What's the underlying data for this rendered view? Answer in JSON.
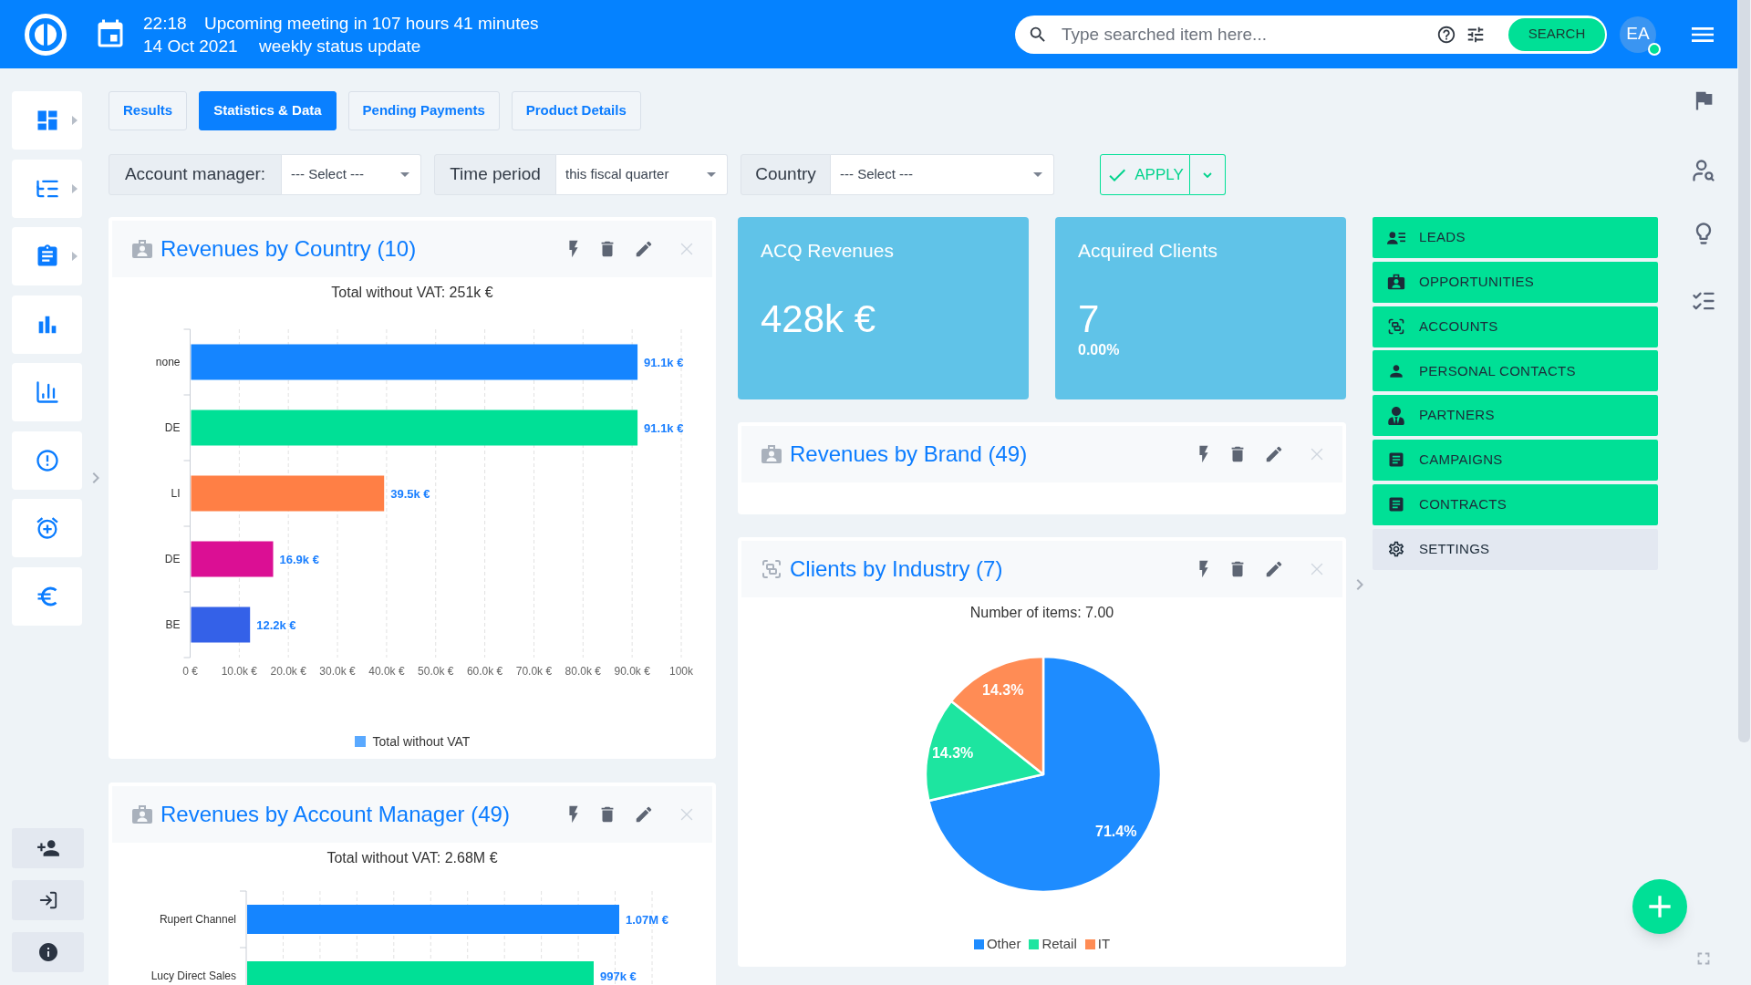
{
  "header": {
    "time": "22:18",
    "meeting": "Upcoming meeting in 107 hours 41 minutes",
    "date": "14 Oct 2021",
    "event": "weekly status update",
    "search": {
      "placeholder": "Type searched item here...",
      "button": "SEARCH"
    },
    "avatar": {
      "initials": "EA",
      "online": true
    }
  },
  "sidebar": {
    "items": [
      {
        "expandable": true
      },
      {
        "expandable": true
      },
      {
        "expandable": true
      },
      {
        "expandable": false
      },
      {
        "expandable": false
      },
      {
        "expandable": false
      },
      {
        "expandable": false
      },
      {
        "expandable": false
      }
    ]
  },
  "tabs": [
    {
      "label": "Results",
      "selected": false
    },
    {
      "label": "Statistics & Data",
      "selected": true
    },
    {
      "label": "Pending Payments",
      "selected": false
    },
    {
      "label": "Product Details",
      "selected": false
    }
  ],
  "filters": {
    "fields": [
      {
        "label": "Account manager:",
        "value": "--- Select ---"
      },
      {
        "label": "Time period",
        "value": "this fiscal quarter"
      },
      {
        "label": "Country",
        "value": "--- Select ---"
      }
    ],
    "apply": "APPLY"
  },
  "left_column": {
    "widgets": [
      {
        "title": "Revenues by Country (10)",
        "chart_data": {
          "type": "bar",
          "orientation": "horizontal",
          "title": "Total without VAT: 251k €",
          "categories": [
            "none",
            "DE",
            "LI",
            "DE",
            "BE"
          ],
          "series": [
            {
              "name": "Total without VAT",
              "color": "#5aa9ff",
              "values": [
                91100,
                91100,
                39500,
                16900,
                12200
              ],
              "colors": [
                "#1585ff",
                "#00e096",
                "#ff7f45",
                "#db0f94",
                "#3461e8"
              ]
            }
          ],
          "value_labels": [
            "91.1k €",
            "91.1k €",
            "39.5k €",
            "16.9k €",
            "12.2k €"
          ],
          "xlim": [
            0,
            100000
          ],
          "xticks": [
            {
              "value": 0,
              "label": "0 €"
            },
            {
              "value": 10000,
              "label": "10.0k €"
            },
            {
              "value": 20000,
              "label": "20.0k €"
            },
            {
              "value": 30000,
              "label": "30.0k €"
            },
            {
              "value": 40000,
              "label": "40.0k €"
            },
            {
              "value": 50000,
              "label": "50.0k €"
            },
            {
              "value": 60000,
              "label": "60.0k €"
            },
            {
              "value": 70000,
              "label": "70.0k €"
            },
            {
              "value": 80000,
              "label": "80.0k €"
            },
            {
              "value": 90000,
              "label": "90.0k €"
            },
            {
              "value": 100000,
              "label": "100k"
            }
          ],
          "grid": true,
          "legend": "bottom"
        }
      },
      {
        "title": "Revenues by Account Manager (49)",
        "chart": {
          "title": "Total without VAT: 2.68M €",
          "rows": [
            {
              "label": "Rupert Channel",
              "value": "1.07M €",
              "color": "#1585ff"
            },
            {
              "label": "Lucy Direct Sales",
              "value": "997k €",
              "color": "#00e096"
            }
          ]
        }
      }
    ]
  },
  "center_column": {
    "kpis": [
      {
        "title": "ACQ Revenues",
        "value": "428k €"
      },
      {
        "title": "Acquired Clients",
        "value": "7",
        "change": "0.00%"
      }
    ],
    "widgets": [
      {
        "title": "Revenues by Brand (49)"
      },
      {
        "title": "Clients by Industry (7)",
        "chart_data": {
          "type": "pie",
          "title": "Number of items: 7.00",
          "categories": [
            "Other",
            "Retail",
            "IT"
          ],
          "series": [
            {
              "values": [
                71.4,
                14.3,
                14.3
              ],
              "colors": [
                "#1e8cff",
                "#1de5a0",
                "#ff8c55"
              ]
            }
          ],
          "value_labels": [
            "71.4%",
            "14.3%",
            "14.3%"
          ],
          "legend": "bottom"
        }
      }
    ]
  },
  "quick_menu": {
    "items": [
      {
        "label": "LEADS",
        "kind": "module"
      },
      {
        "label": "OPPORTUNITIES",
        "kind": "module"
      },
      {
        "label": "ACCOUNTS",
        "kind": "module"
      },
      {
        "label": "PERSONAL CONTACTS",
        "kind": "module"
      },
      {
        "label": "PARTNERS",
        "kind": "module"
      },
      {
        "label": "CAMPAIGNS",
        "kind": "module"
      },
      {
        "label": "CONTRACTS",
        "kind": "module"
      },
      {
        "label": "SETTINGS",
        "kind": "settings"
      }
    ]
  }
}
